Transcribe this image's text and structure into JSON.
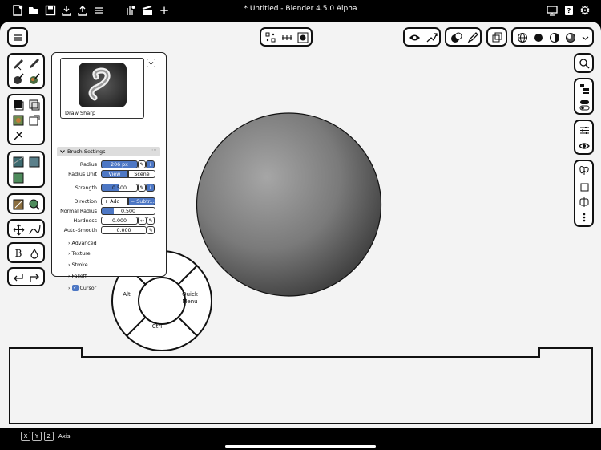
{
  "window": {
    "title": "* Untitled - Blender 4.5.0 Alpha"
  },
  "topbar": {
    "left_icons": [
      "new-file-icon",
      "open-folder-icon",
      "save-icon",
      "import-icon",
      "export-icon",
      "menu-lines-icon",
      "keyframe-icon",
      "clapper-icon",
      "plus-icon"
    ],
    "right_icons": [
      "monitor-icon",
      "help-book-icon",
      "gear-icon"
    ]
  },
  "brush": {
    "name": "Draw Sharp",
    "settings_header": "Brush Settings",
    "radius_label": "Radius",
    "radius_value": "206 px",
    "radius_unit_label": "Radius Unit",
    "unit_view": "View",
    "unit_scene": "Scene",
    "strength_label": "Strength",
    "strength_value": "0.500",
    "direction_label": "Direction",
    "direction_add": "Add",
    "direction_subtract": "Subtr...",
    "normal_radius_label": "Normal Radius",
    "normal_radius_value": "0.500",
    "hardness_label": "Hardness",
    "hardness_value": "0.000",
    "autosmooth_label": "Auto-Smooth",
    "autosmooth_value": "0.000",
    "strength_fill": 0.5,
    "normal_radius_fill": 0.5,
    "sections": [
      "Advanced",
      "Texture",
      "Stroke",
      "Falloff"
    ],
    "cursor_label": "Cursor"
  },
  "pie_menu": {
    "alt": "Alt",
    "ctrl": "Ctrl",
    "quick_line1": "Quick",
    "quick_line2": "Menu"
  },
  "statusbar": {
    "keys": [
      "X",
      "Y",
      "Z"
    ],
    "axis_label": "Axis"
  },
  "colors": {
    "accent": "#4d77c4",
    "background": "#f3f3f3",
    "bar": "#000000"
  }
}
